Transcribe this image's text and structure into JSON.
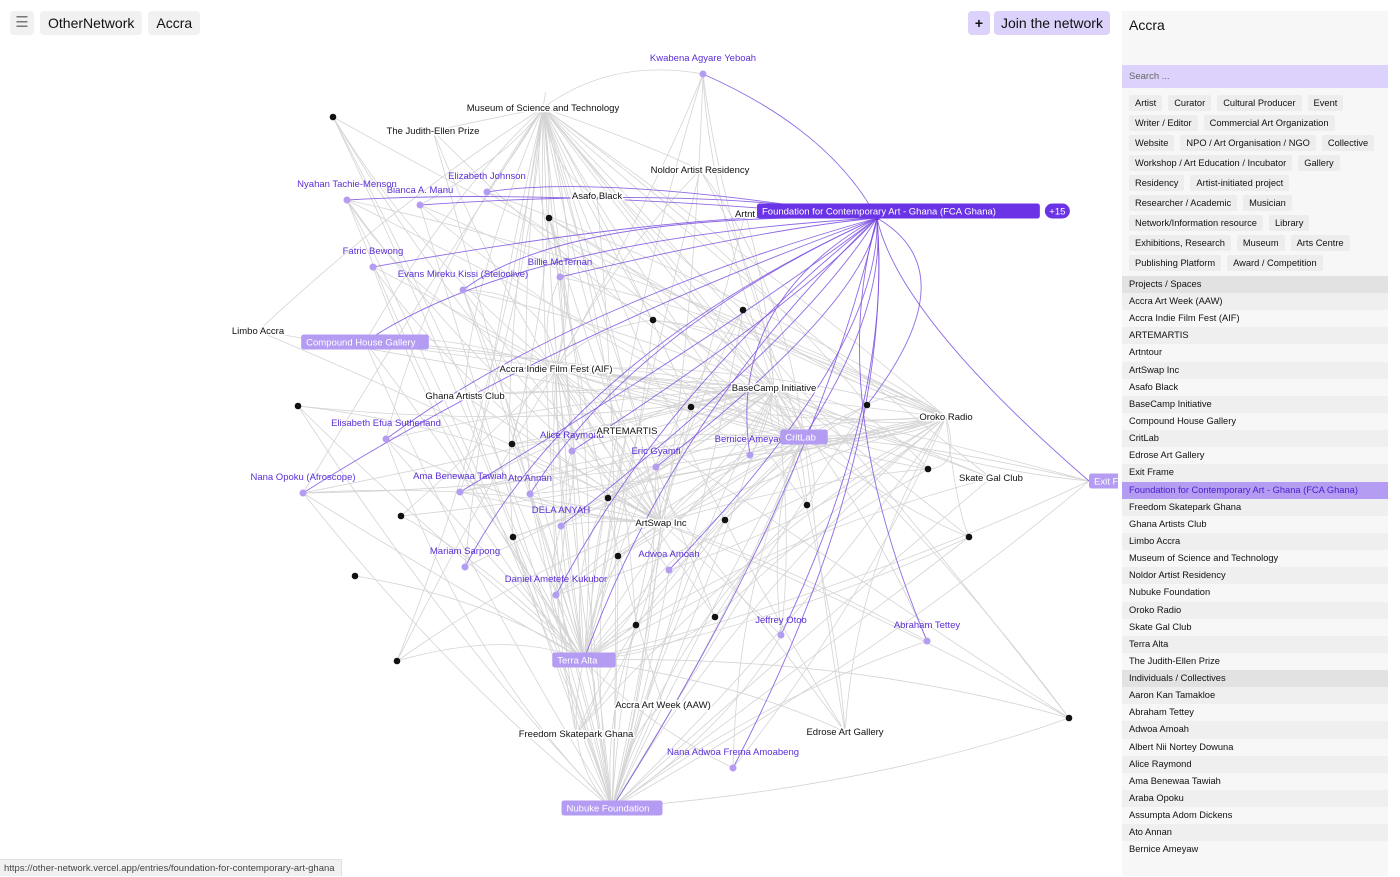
{
  "header": {
    "menu_icon": "hamburger-icon",
    "app_name": "OtherNetwork",
    "city": "Accra",
    "add_label": "+",
    "join_label": "Join the network"
  },
  "colors": {
    "accent": "#7b4fe0",
    "accent_light": "#dcd2fb",
    "node_box": "#b49cf3",
    "edge": "#d4d4d4",
    "selected_node": "#6a33e6"
  },
  "panel": {
    "title": "Accra",
    "search_placeholder": "Search ...",
    "tags": [
      "Artist",
      "Curator",
      "Cultural Producer",
      "Event",
      "Writer / Editor",
      "Commercial Art Organization",
      "Website",
      "NPO / Art Organisation / NGO",
      "Collective",
      "Workshop / Art Education / Incubator",
      "Gallery",
      "Residency",
      "Artist-initiated project",
      "Researcher / Academic",
      "Musician",
      "Network/Information resource",
      "Library",
      "Exhibitions, Research",
      "Museum",
      "Arts Centre",
      "Publishing Platform",
      "Award / Competition"
    ],
    "sections": [
      {
        "heading": "Projects / Spaces",
        "items": [
          "Accra Art Week (AAW)",
          "Accra Indie Film Fest (AIF)",
          "ARTEMARTIS",
          "Artntour",
          "ArtSwap Inc",
          "Asafo Black",
          "BaseCamp Initiative",
          "Compound House Gallery",
          "CritLab",
          "Edrose Art Gallery",
          "Exit Frame",
          "Foundation for Contemporary Art - Ghana (FCA Ghana)",
          "Freedom Skatepark Ghana",
          "Ghana Artists Club",
          "Limbo Accra",
          "Museum of Science and Technology",
          "Noldor Artist Residency",
          "Nubuke Foundation",
          "Oroko Radio",
          "Skate Gal Club",
          "Terra Alta",
          "The Judith-Ellen Prize"
        ]
      },
      {
        "heading": "Individuals / Collectives",
        "items": [
          "Aaron Kan Tamakloe",
          "Abraham Tettey",
          "Adwoa Amoah",
          "Albert Nii Nortey Dowuna",
          "Alice Raymond",
          "Ama Benewaa Tawiah",
          "Araba Opoku",
          "Assumpta Adom Dickens",
          "Ato Annan",
          "Bernice Ameyaw"
        ]
      }
    ],
    "selected_item": "Foundation for Contemporary Art - Ghana (FCA Ghana)"
  },
  "graph": {
    "selected": {
      "label": "Foundation for Contemporary Art - Ghana (FCA Ghana)",
      "badge": "+15"
    },
    "boxed_nodes": [
      {
        "label": "Compound House Gallery"
      },
      {
        "label": "CritLab"
      },
      {
        "label": "Terra Alta"
      },
      {
        "label": "Nubuke Foundation"
      },
      {
        "label": "Exit Fra"
      }
    ],
    "people": [
      {
        "label": "Kwabena Agyare Yeboah"
      },
      {
        "label": "Nyahan Tachie-Menson"
      },
      {
        "label": "Bianca A. Manu"
      },
      {
        "label": "Elizabeth Johnson"
      },
      {
        "label": "Fatric Bewong"
      },
      {
        "label": "Evans Mireku Kissi (Steloolive)"
      },
      {
        "label": "Billie McTernan"
      },
      {
        "label": "Elisabeth Efua Sutherland"
      },
      {
        "label": "Alice Raymond"
      },
      {
        "label": "Bernice Ameyaw"
      },
      {
        "label": "Eric Gyamfi"
      },
      {
        "label": "Nana Opoku (Afroscope)"
      },
      {
        "label": "Ama Benewaa Tawiah"
      },
      {
        "label": "Ato Annan"
      },
      {
        "label": "DELA ANYAH"
      },
      {
        "label": "Mariam Sarpong"
      },
      {
        "label": "Adwoa Amoah"
      },
      {
        "label": "Daniel Ametefe Kukubor"
      },
      {
        "label": "Jeffrey Otoo"
      },
      {
        "label": "Abraham Tettey"
      },
      {
        "label": "Nana Adwoa Frema Amoabeng"
      }
    ],
    "places": [
      {
        "label": "Museum of Science and Technology"
      },
      {
        "label": "The Judith-Ellen Prize"
      },
      {
        "label": "Noldor Artist Residency"
      },
      {
        "label": "Asafo Black"
      },
      {
        "label": "Artnt"
      },
      {
        "label": "Limbo Accra"
      },
      {
        "label": "Accra Indie Film Fest (AIF)"
      },
      {
        "label": "BaseCamp Initiative"
      },
      {
        "label": "Ghana Artists Club"
      },
      {
        "label": "Oroko Radio"
      },
      {
        "label": "ARTEMARTIS"
      },
      {
        "label": "Skate Gal Club"
      },
      {
        "label": "ArtSwap Inc"
      },
      {
        "label": "Accra Art Week (AAW)"
      },
      {
        "label": "Freedom Skatepark Ghana"
      },
      {
        "label": "Edrose Art Gallery"
      }
    ]
  },
  "status": {
    "url": "https://other-network.vercel.app/entries/foundation-for-contemporary-art-ghana"
  }
}
